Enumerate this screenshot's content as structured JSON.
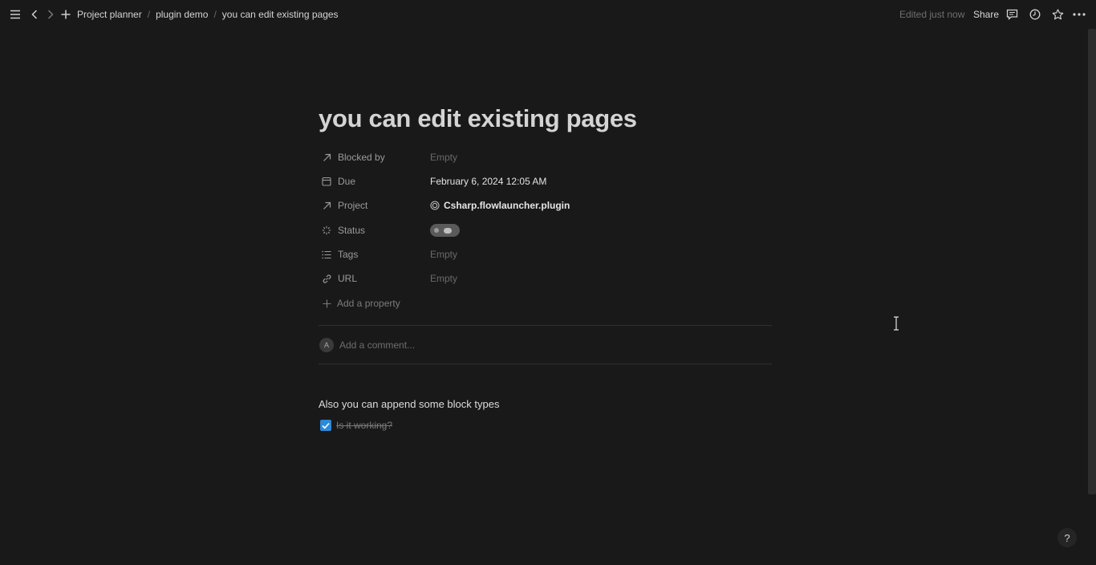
{
  "topbar": {
    "breadcrumbs": [
      "Project planner",
      "plugin demo",
      "you can edit existing pages"
    ],
    "separator": "/",
    "edited": "Edited just now",
    "share_label": "Share",
    "icons": [
      "menu-icon",
      "back-icon",
      "forward-icon",
      "plus-icon",
      "comment-icon",
      "history-icon",
      "star-icon",
      "more-icon"
    ]
  },
  "page": {
    "title": "you can edit existing pages",
    "properties": [
      {
        "name": "Blocked by",
        "value": "Empty",
        "icon": "relation-arrow-icon"
      },
      {
        "name": "Due",
        "value": "February 6, 2024 12:05 AM",
        "icon": "calendar-icon"
      },
      {
        "name": "Project",
        "value": "Csharp.flowlauncher.plugin",
        "icon": "relation-arrow-icon"
      },
      {
        "name": "Status",
        "value": "",
        "icon": "status-icon"
      },
      {
        "name": "Tags",
        "value": "Empty",
        "icon": "list-icon"
      },
      {
        "name": "URL",
        "value": "Empty",
        "icon": "link-icon"
      }
    ],
    "add_property": "Add a property",
    "comment": {
      "avatar": "A",
      "placeholder": "Add a comment..."
    },
    "paragraph": "Also you can append some block types",
    "todo": {
      "text": "Is it working?",
      "checked": true
    }
  },
  "help_label": "?",
  "colors": {
    "background": "#191919",
    "text": "#d4d4d4",
    "checkbox": "#2e88d8"
  }
}
